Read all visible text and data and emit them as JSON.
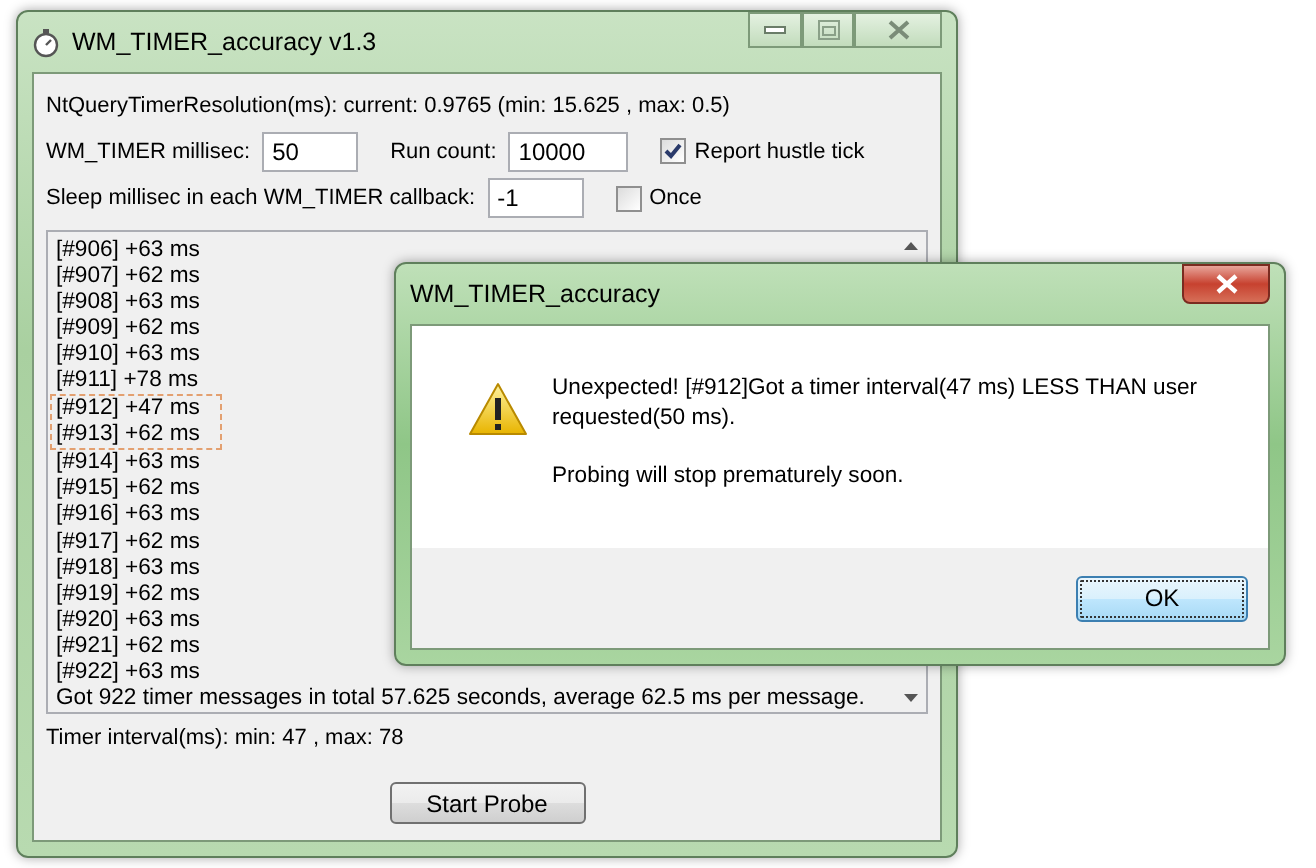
{
  "main_window": {
    "title": "WM_TIMER_accuracy v1.3",
    "resolution_text": "NtQueryTimerResolution(ms): current: 0.9765  (min: 15.625 , max: 0.5)",
    "fields": [
      {
        "label": "WM_TIMER millisec:",
        "value": "50"
      },
      {
        "label": "Run count:",
        "value": "10000"
      }
    ],
    "report_checkbox": {
      "label": "Report hustle tick",
      "checked": true
    },
    "sleep_field": {
      "label": "Sleep millisec in each WM_TIMER callback:",
      "value": "-1"
    },
    "once_checkbox": {
      "label": "Once",
      "checked": false
    },
    "log": {
      "lines": [
        {
          "text": "[#906] +63 ms",
          "highlighted": false
        },
        {
          "text": "[#907] +62 ms",
          "highlighted": false
        },
        {
          "text": "[#908] +63 ms",
          "highlighted": false
        },
        {
          "text": "[#909] +62 ms",
          "highlighted": false
        },
        {
          "text": "[#910] +63 ms",
          "highlighted": false
        },
        {
          "text": "[#911] +78 ms",
          "highlighted": false
        },
        {
          "text": "[#912] +47 ms",
          "highlighted": true
        },
        {
          "text": "[#913] +62 ms",
          "highlighted": true
        },
        {
          "text": "[#914] +63 ms",
          "highlighted": false
        },
        {
          "text": "[#915] +62 ms",
          "highlighted": false
        },
        {
          "text": "[#916] +63 ms",
          "highlighted": false
        },
        {
          "text": "[#917] +62 ms",
          "highlighted": false
        },
        {
          "text": "[#918] +63 ms",
          "highlighted": false
        },
        {
          "text": "[#919] +62 ms",
          "highlighted": false
        },
        {
          "text": "[#920] +63 ms",
          "highlighted": false
        },
        {
          "text": "[#921] +62 ms",
          "highlighted": false
        },
        {
          "text": "[#922] +63 ms",
          "highlighted": false
        }
      ],
      "summary": "Got 922 timer messages in total 57.625 seconds, average 62.5 ms per message."
    },
    "interval_text": "Timer interval(ms): min: 47 , max: 78",
    "start_button": "Start Probe"
  },
  "dialog": {
    "title": "WM_TIMER_accuracy",
    "message": "Unexpected! [#912]Got a timer interval(47 ms) LESS THAN user requested(50 ms).",
    "note": "Probing will stop prematurely soon.",
    "ok_button": "OK"
  }
}
